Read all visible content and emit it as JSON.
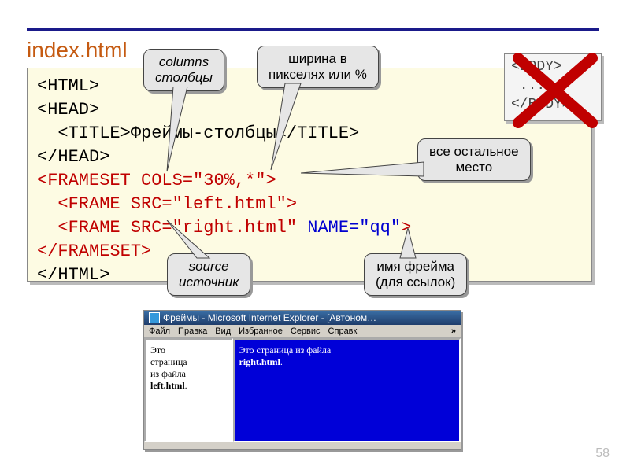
{
  "title": "index.html",
  "code": {
    "l1": "<HTML>",
    "l2": "<HEAD>",
    "l3a": "  <TITLE>",
    "l3b": "Фреймы-столбцы",
    "l3c": "</TITLE>",
    "l4": "</HEAD>",
    "l5a": "<FRAMESET ",
    "l5b": "COLS=\"30%,*\"",
    "l5c": ">",
    "l6a": "  <FRAME ",
    "l6b": "SRC=\"left.html\"",
    "l6c": ">",
    "l7a": "  <FRAME ",
    "l7b": "SRC=\"right.html\" ",
    "l7c": "NAME=\"qq\"",
    "l7d": ">",
    "l8": "</FRAMESET>",
    "l9": "</HTML>"
  },
  "bodybox": "<BODY>\n ...\n</BODY>",
  "bubbles": {
    "columns": "columns\nстолбцы",
    "width": "ширина в\nпикселях или %",
    "rest": "все остальное\nместо",
    "source": "source\nисточник",
    "name": "имя фрейма\n(для ссылок)"
  },
  "browser": {
    "title": "Фреймы - Microsoft Internet Explorer - [Автоном…",
    "menu": [
      "Файл",
      "Правка",
      "Вид",
      "Избранное",
      "Сервис",
      "Справк"
    ],
    "chev": "»",
    "left_text": "Это\nстраница\nиз файла",
    "left_bold": "left.html",
    "right_text": "Это страница из файла",
    "right_bold": "right.html"
  },
  "pagenum": "58"
}
